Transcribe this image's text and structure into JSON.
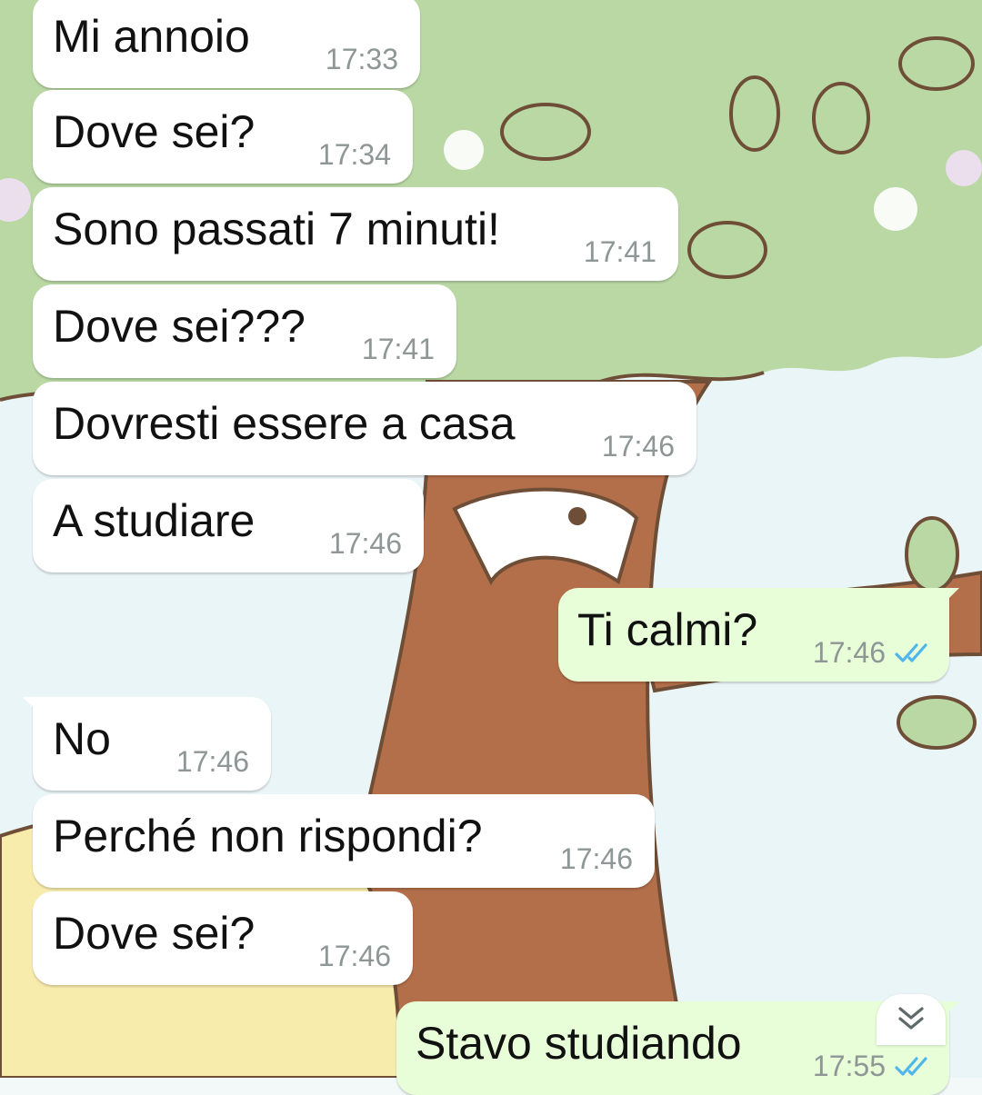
{
  "messages": [
    {
      "direction": "incoming",
      "text": "Mi annoio",
      "time": "17:33"
    },
    {
      "direction": "incoming",
      "text": "Dove sei?",
      "time": "17:34"
    },
    {
      "direction": "incoming",
      "text": "Sono passati 7 minuti!",
      "time": "17:41"
    },
    {
      "direction": "incoming",
      "text": "Dove sei???",
      "time": "17:41"
    },
    {
      "direction": "incoming",
      "text": "Dovresti essere a casa",
      "time": "17:46"
    },
    {
      "direction": "incoming",
      "text": "A studiare",
      "time": "17:46"
    },
    {
      "direction": "outgoing",
      "text": "Ti calmi?",
      "time": "17:46",
      "status": "read"
    },
    {
      "direction": "incoming",
      "text": "No",
      "time": "17:46"
    },
    {
      "direction": "incoming",
      "text": "Perché non rispondi?",
      "time": "17:46"
    },
    {
      "direction": "incoming",
      "text": "Dove sei?",
      "time": "17:46"
    },
    {
      "direction": "outgoing",
      "text": "Stavo studiando",
      "time": "17:55",
      "status": "read"
    }
  ],
  "icons": {
    "read_receipt": "double-check-icon",
    "scroll_down": "double-chevron-down-icon"
  },
  "colors": {
    "incoming_bubble": "#ffffff",
    "outgoing_bubble": "#e7fed8",
    "read_tick": "#4fb6ec",
    "timestamp": "#8e9696",
    "foliage": "#b9d8a4",
    "trunk": "#b36f4a",
    "sky": "#eaf5f7",
    "ground": "#f8ecad"
  }
}
